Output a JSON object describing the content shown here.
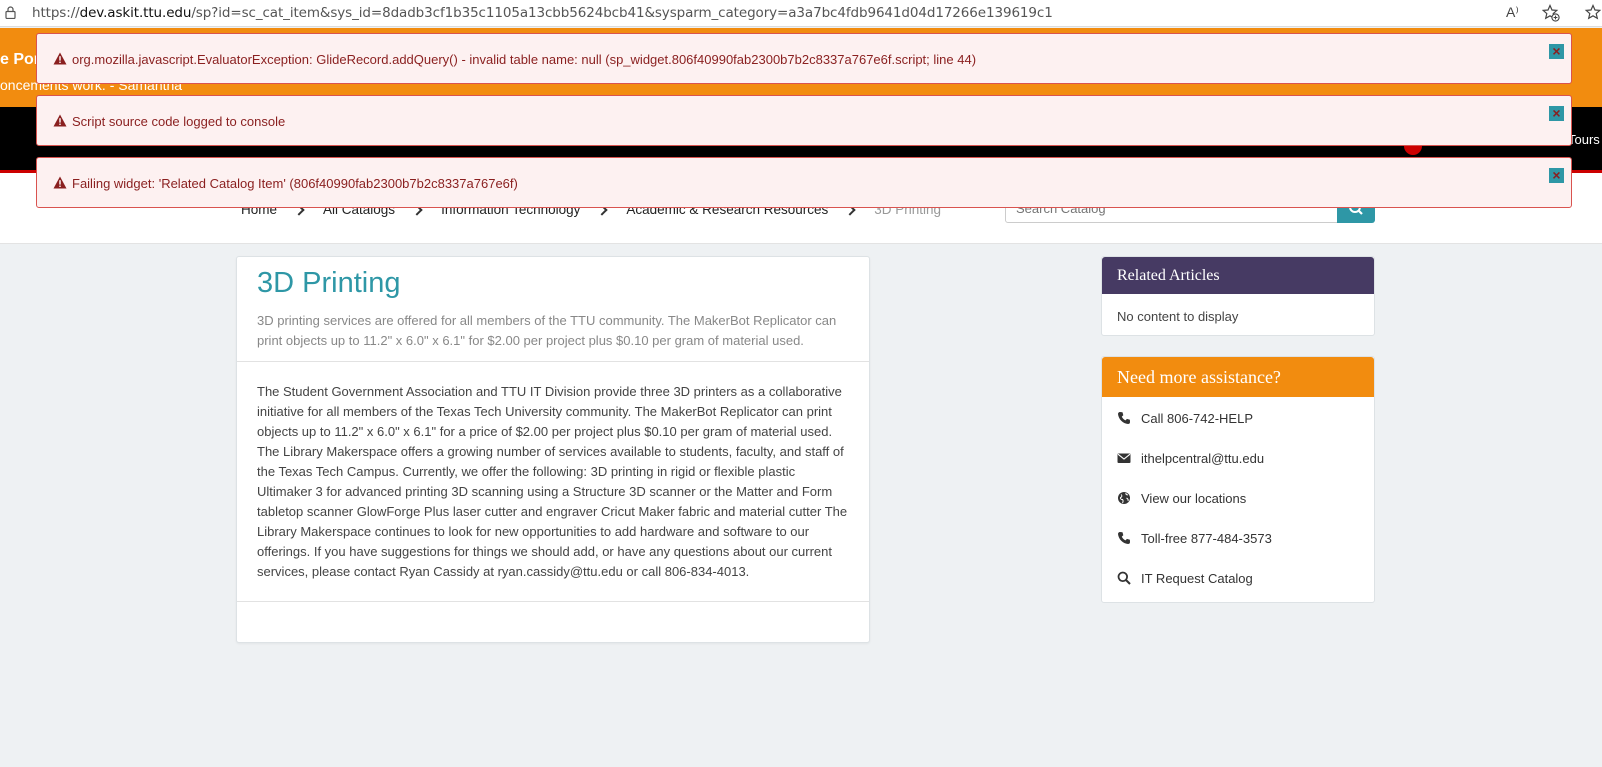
{
  "browser": {
    "url_prefix": "https://",
    "url_host": "dev.askit.ttu.edu",
    "url_path": "/sp?id=sc_cat_item&sys_id=8dadb3cf1b35c1105a13cbb5624bcb41&sysparm_category=a3a7bc4fdb9641d04d17266e139619c1",
    "read_aloud_glyph": "A⁾"
  },
  "banner": {
    "title": "e Por",
    "text": "oncements work. - Samantha",
    "color": "#f28c0f"
  },
  "navbar": {
    "tours_label": "Tours"
  },
  "breadcrumb": {
    "items": [
      "Home",
      "All Catalogs",
      "Information Technology",
      "Academic & Research Resources"
    ],
    "current": "3D Printing"
  },
  "search": {
    "placeholder": "Search Catalog"
  },
  "alerts": [
    {
      "message": "org.mozilla.javascript.EvaluatorException: GlideRecord.addQuery() - invalid table name: null (sp_widget.806f40990fab2300b7b2c8337a767e6f.script; line 44)",
      "close": "×"
    },
    {
      "message": "Script source code logged to console",
      "close": "×"
    },
    {
      "message": "Failing widget: 'Related Catalog Item' (806f40990fab2300b7b2c8337a767e6f)",
      "close": "×"
    }
  ],
  "item": {
    "title": "3D Printing",
    "short_description": "3D printing services are offered for all members of the TTU community. The MakerBot Replicator can print objects up to 11.2\" x 6.0\" x 6.1\" for $2.00 per project plus $0.10 per gram of material used.",
    "description": "The Student Government Association and TTU IT Division provide three 3D printers as a collaborative initiative for all members of the Texas Tech University community. The MakerBot Replicator can print objects up to 11.2\" x 6.0\" x 6.1\" for a price of $2.00 per project plus $0.10 per gram of material used. The Library Makerspace offers a growing number of services available to students, faculty, and staff of the Texas Tech Campus. Currently, we offer the following: 3D printing in rigid or flexible plastic Ultimaker 3 for advanced printing 3D scanning using a Structure 3D scanner or the Matter and Form tabletop scanner GlowForge Plus laser cutter and engraver Cricut Maker fabric and material cutter The Library Makerspace continues to look for new opportunities to add hardware and software to our offerings. If you have suggestions for things we should add, or have any questions about our current services, please contact Ryan Cassidy at ryan.cassidy@ttu.edu or call 806-834-4013."
  },
  "related_articles": {
    "title": "Related Articles",
    "empty_text": "No content to display",
    "header_color": "#463a63"
  },
  "assistance": {
    "title": "Need more assistance?",
    "header_color": "#f28c0f",
    "items": [
      {
        "icon": "phone-icon",
        "label": "Call 806-742-HELP"
      },
      {
        "icon": "envelope-icon",
        "label": "ithelpcentral@ttu.edu"
      },
      {
        "icon": "globe-icon",
        "label": "View our locations"
      },
      {
        "icon": "phone-icon",
        "label": "Toll-free 877-484-3573"
      },
      {
        "icon": "search-icon",
        "label": "IT Request Catalog"
      }
    ]
  },
  "colors": {
    "accent_teal": "#2e97a6",
    "alert_text": "#8a1f1f",
    "alert_border": "#d9534f"
  }
}
